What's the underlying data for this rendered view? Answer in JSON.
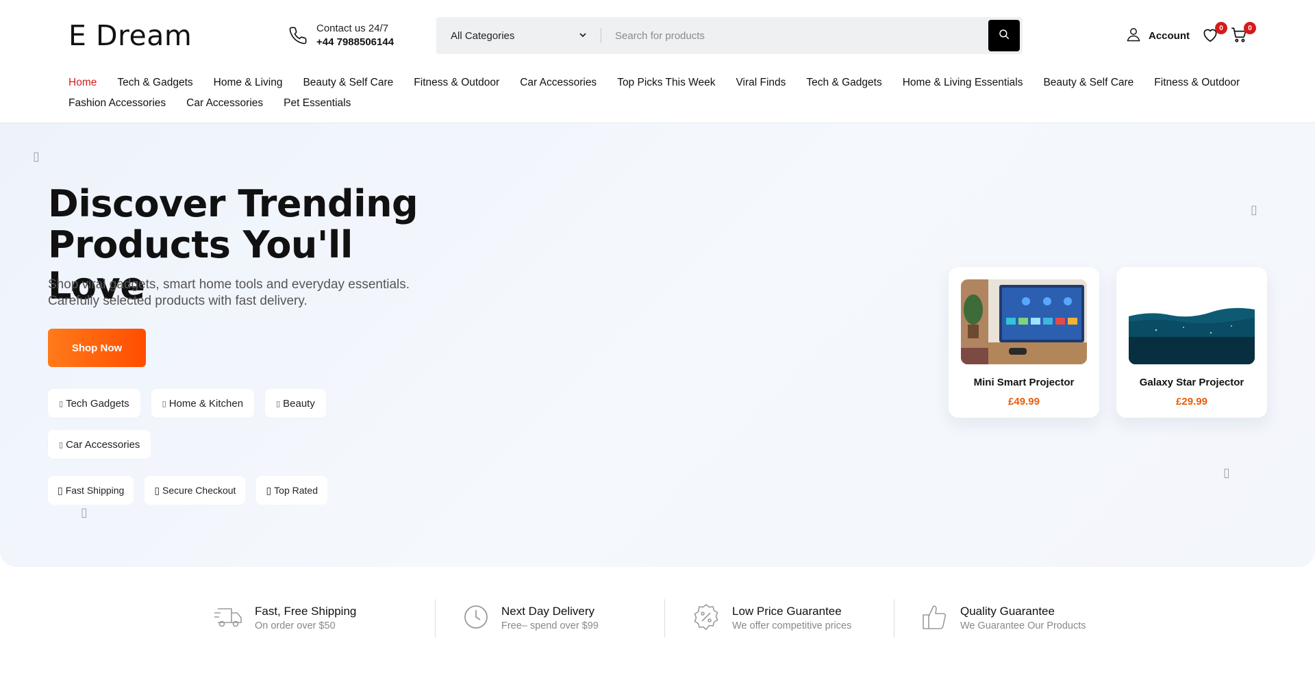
{
  "header": {
    "logo": "E Dream",
    "contact_line1": "Contact us 24/7",
    "contact_phone": "+44 7988506144",
    "category_selected": "All Categories",
    "search_placeholder": "Search for products",
    "account_label": "Account",
    "wishlist_count": "0",
    "cart_count": "0"
  },
  "nav": [
    "Home",
    "Tech & Gadgets",
    "Home & Living",
    "Beauty & Self Care",
    "Fitness & Outdoor",
    "Car Accessories",
    "Top Picks This Week",
    "Viral Finds",
    "Tech & Gadgets",
    "Home & Living Essentials",
    "Beauty & Self Care",
    "Fitness & Outdoor",
    "Fashion Accessories",
    "Car Accessories",
    "Pet Essentials"
  ],
  "hero": {
    "title_line1": "Discover Trending",
    "title_line2": "Products You'll Love",
    "subtitle": "Shop viral gadgets, smart home tools and everyday essentials. Carefully selected products with fast delivery.",
    "cta": "Shop Now",
    "chips": [
      "Tech Gadgets",
      "Home & Kitchen",
      "Beauty",
      "Car Accessories"
    ],
    "feature_chips": [
      "Fast Shipping",
      "Secure Checkout",
      "Top Rated"
    ],
    "products": [
      {
        "name": "Mini Smart Projector",
        "price": "£49.99"
      },
      {
        "name": "Galaxy Star Projector",
        "price": "£29.99"
      }
    ]
  },
  "features": [
    {
      "title": "Fast, Free Shipping",
      "desc": "On order over $50",
      "icon": "truck-icon"
    },
    {
      "title": "Next Day Delivery",
      "desc": "Free– spend over $99",
      "icon": "clock-icon"
    },
    {
      "title": "Low Price Guarantee",
      "desc": "We offer competitive prices",
      "icon": "percent-badge-icon"
    },
    {
      "title": "Quality Guarantee",
      "desc": "We Guarantee Our Products",
      "icon": "thumbs-up-icon"
    }
  ],
  "colors": {
    "accent": "#d71a1a",
    "cta": "#ff6a0a",
    "price": "#e85d0a"
  }
}
